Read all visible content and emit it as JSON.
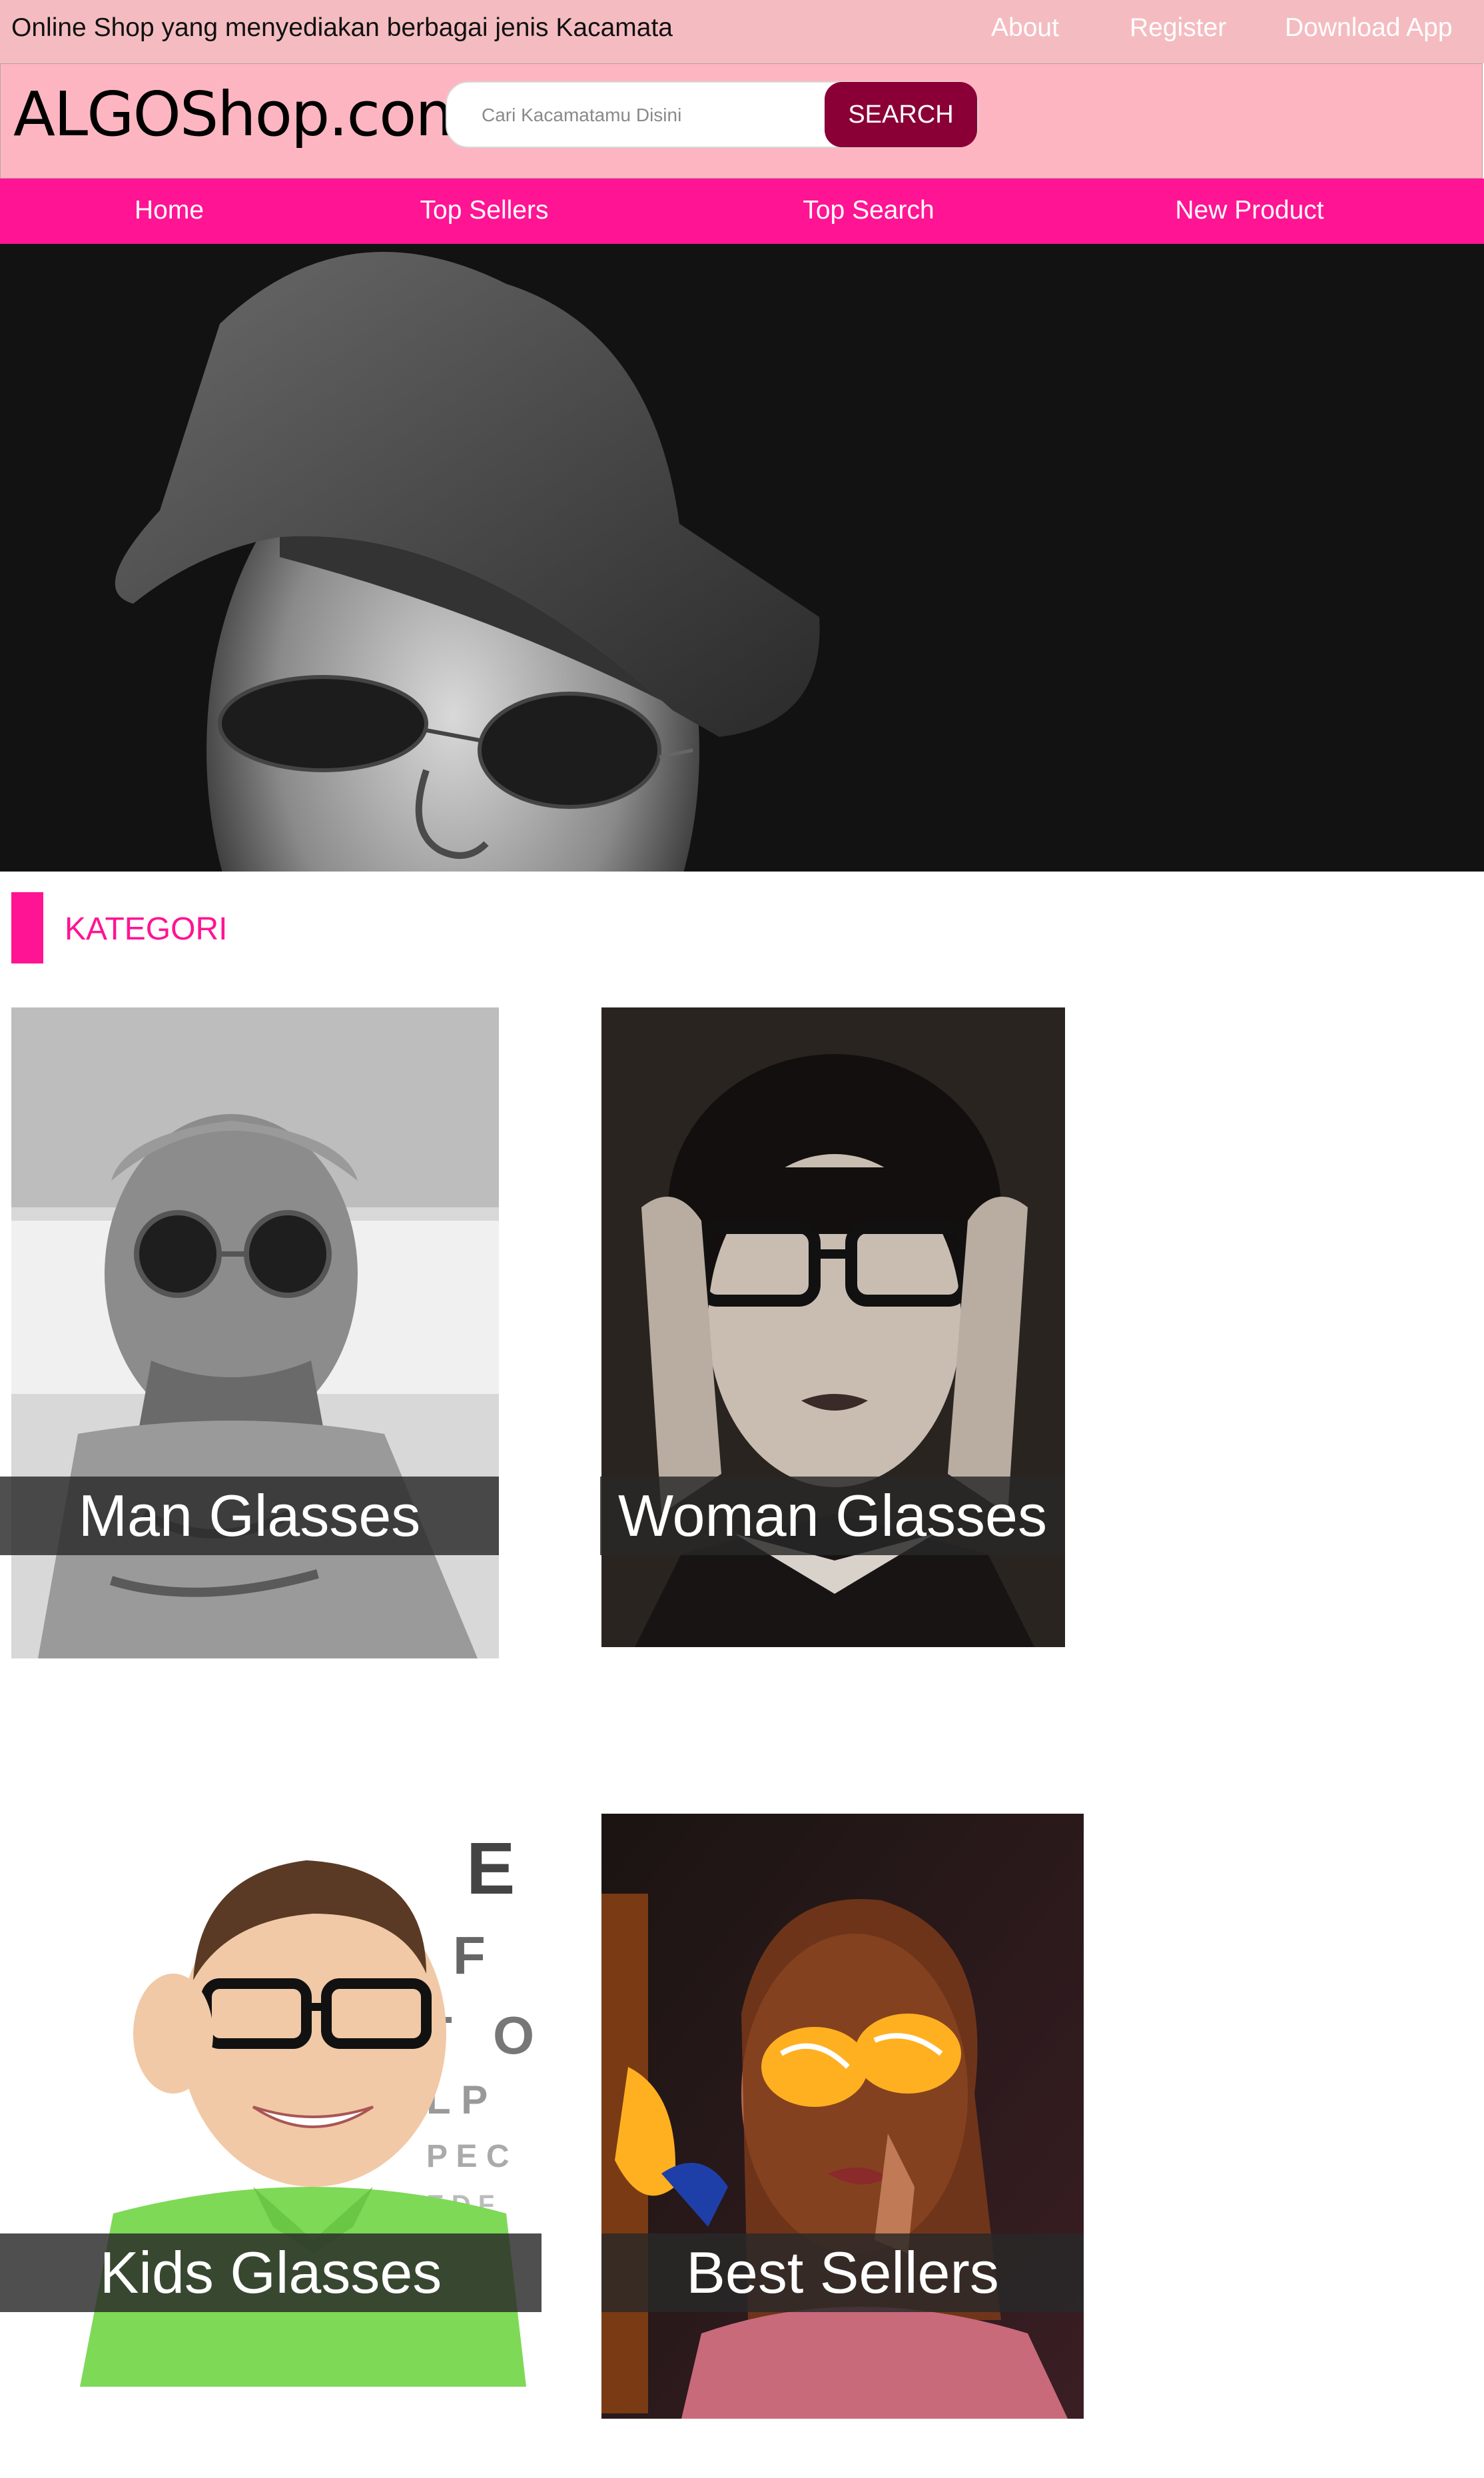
{
  "topbar": {
    "tagline": "Online Shop yang menyediakan berbagai jenis Kacamata",
    "links": [
      "About",
      "Register",
      "Download App"
    ]
  },
  "header": {
    "logo": "ALGOShop.com",
    "search": {
      "placeholder": "Cari Kacamatamu Disini",
      "button_label": "SEARCH"
    }
  },
  "nav": {
    "items": [
      "Home",
      "Top Sellers",
      "Top Search",
      "New Product"
    ]
  },
  "section": {
    "title": "KATEGORI"
  },
  "categories": [
    {
      "label": "Man Glasses"
    },
    {
      "label": "Woman Glasses"
    },
    {
      "label": "Kids Glasses"
    },
    {
      "label": "Best Sellers"
    }
  ],
  "colors": {
    "topbar": "#f4bcc1",
    "header": "#fdb6c1",
    "accent": "#ff1493",
    "search_button": "#8a0036"
  }
}
